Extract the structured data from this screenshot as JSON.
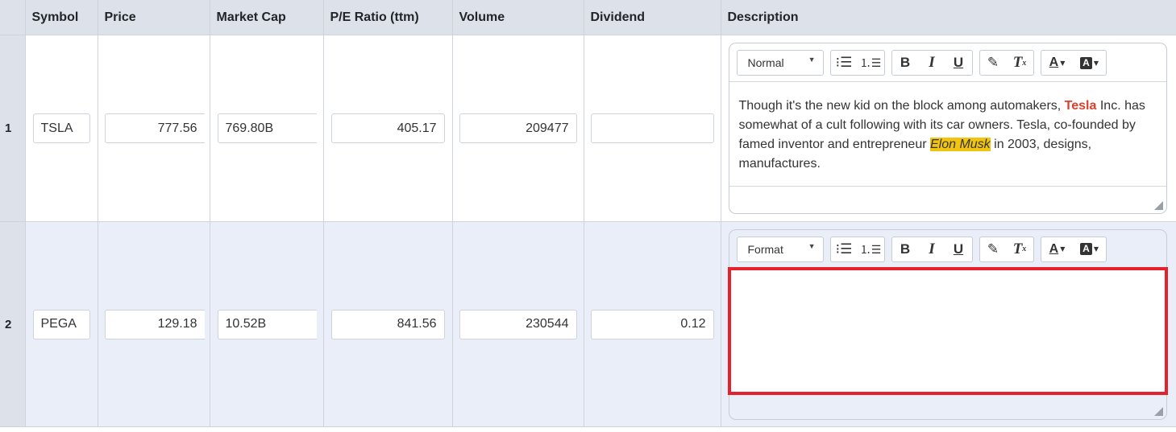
{
  "columns": [
    "Symbol",
    "Price",
    "Market Cap",
    "P/E Ratio (ttm)",
    "Volume",
    "Dividend",
    "Description"
  ],
  "rows": [
    {
      "num": "1",
      "symbol": "TSLA",
      "price": "777.56",
      "market_cap": "769.80B",
      "pe_ratio": "405.17",
      "volume": "209477",
      "dividend": "",
      "editor": {
        "format_label": "Normal",
        "text_part1": "Though it's the new kid on the block among automakers, ",
        "text_bold": "Tesla",
        "text_part2": " Inc. has somewhat of a cult following with its car owners. Tesla, co-founded by famed inventor and entrepreneur ",
        "text_highlight": "Elon Musk",
        "text_part3": " in 2003, designs, manufactures."
      }
    },
    {
      "num": "2",
      "symbol": "PEGA",
      "price": "129.18",
      "market_cap": "10.52B",
      "pe_ratio": "841.56",
      "volume": "230544",
      "dividend": "0.12",
      "editor": {
        "format_label": "Format",
        "text": ""
      }
    }
  ],
  "toolbar_icons": [
    "bullet-list-icon",
    "numbered-list-icon",
    "bold-icon",
    "italic-icon",
    "underline-icon",
    "paint-brush-icon",
    "clear-format-icon",
    "text-color-icon",
    "background-color-icon"
  ],
  "colors": {
    "header_bg": "#dde2ea",
    "row_alt_bg": "#e9eef8",
    "tesla_text": "#e03e2d",
    "highlight": "#f1c40f",
    "focus_border": "#e5212b"
  }
}
